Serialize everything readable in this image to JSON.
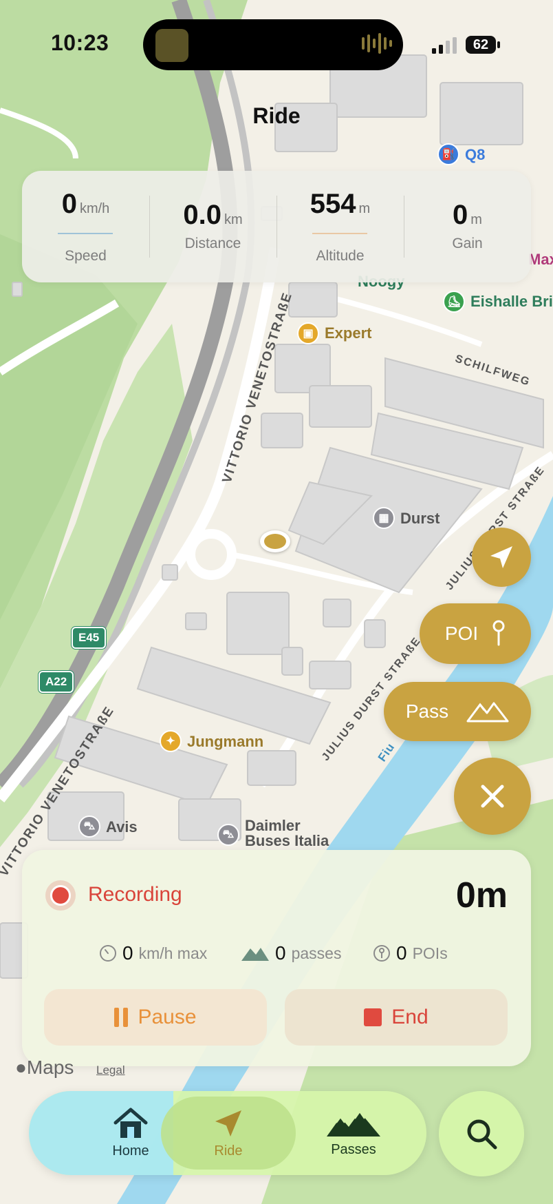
{
  "status_bar": {
    "time": "10:23",
    "battery": "62"
  },
  "header": {
    "title": "Ride"
  },
  "stats": [
    {
      "value": "0",
      "unit": "km/h",
      "label": "Speed",
      "accent": "#9fc3d8"
    },
    {
      "value": "0.0",
      "unit": "km",
      "label": "Distance",
      "accent": ""
    },
    {
      "value": "554",
      "unit": "m",
      "label": "Altitude",
      "accent": "#e9c7a4"
    },
    {
      "value": "0",
      "unit": "m",
      "label": "Gain",
      "accent": ""
    }
  ],
  "map": {
    "pois": {
      "q8": "Q8",
      "noogy": "Noogy",
      "eishalle": "Eishalle Bri",
      "max": "Max",
      "expert": "Expert",
      "durst": "Durst",
      "jungmann": "Jungmann",
      "avis": "Avis",
      "daimler": "Daimler\nBuses Italia"
    },
    "streets": {
      "vittorio_upper": "VITTORIO VENETOSTRAßE",
      "vittorio_lower": "VITTORIO VENETOSTRAßE",
      "schilfweg": "SCHILFWEG",
      "julius_upper": "JULIUS DURST STRAßE",
      "julius_lower": "JULIUS DURST STRAßE",
      "river": "Fiu"
    },
    "shields": {
      "e45": "E45",
      "a22": "A22"
    },
    "attribution": {
      "maps": "Maps",
      "legal": "Legal"
    }
  },
  "fabs": {
    "locate_icon": "navigation-arrow-icon",
    "poi_label": "POI",
    "pass_label": "Pass",
    "close_icon": "close-icon"
  },
  "recording": {
    "status": "Recording",
    "distance": "0m",
    "max_speed": {
      "value": "0",
      "label": "km/h max"
    },
    "passes": {
      "value": "0",
      "label": "passes"
    },
    "pois": {
      "value": "0",
      "label": "POIs"
    },
    "pause_label": "Pause",
    "end_label": "End"
  },
  "tabbar": {
    "tabs": [
      {
        "label": "Home",
        "icon": "house-icon"
      },
      {
        "label": "Ride",
        "icon": "navigation-arrow-icon"
      },
      {
        "label": "Passes",
        "icon": "mountains-icon"
      }
    ],
    "search_icon": "search-icon"
  },
  "colors": {
    "accent_gold": "#c9a341",
    "recording_red": "#d9443a",
    "pause_orange": "#e8913a",
    "tab_green": "#d6f5aa"
  }
}
